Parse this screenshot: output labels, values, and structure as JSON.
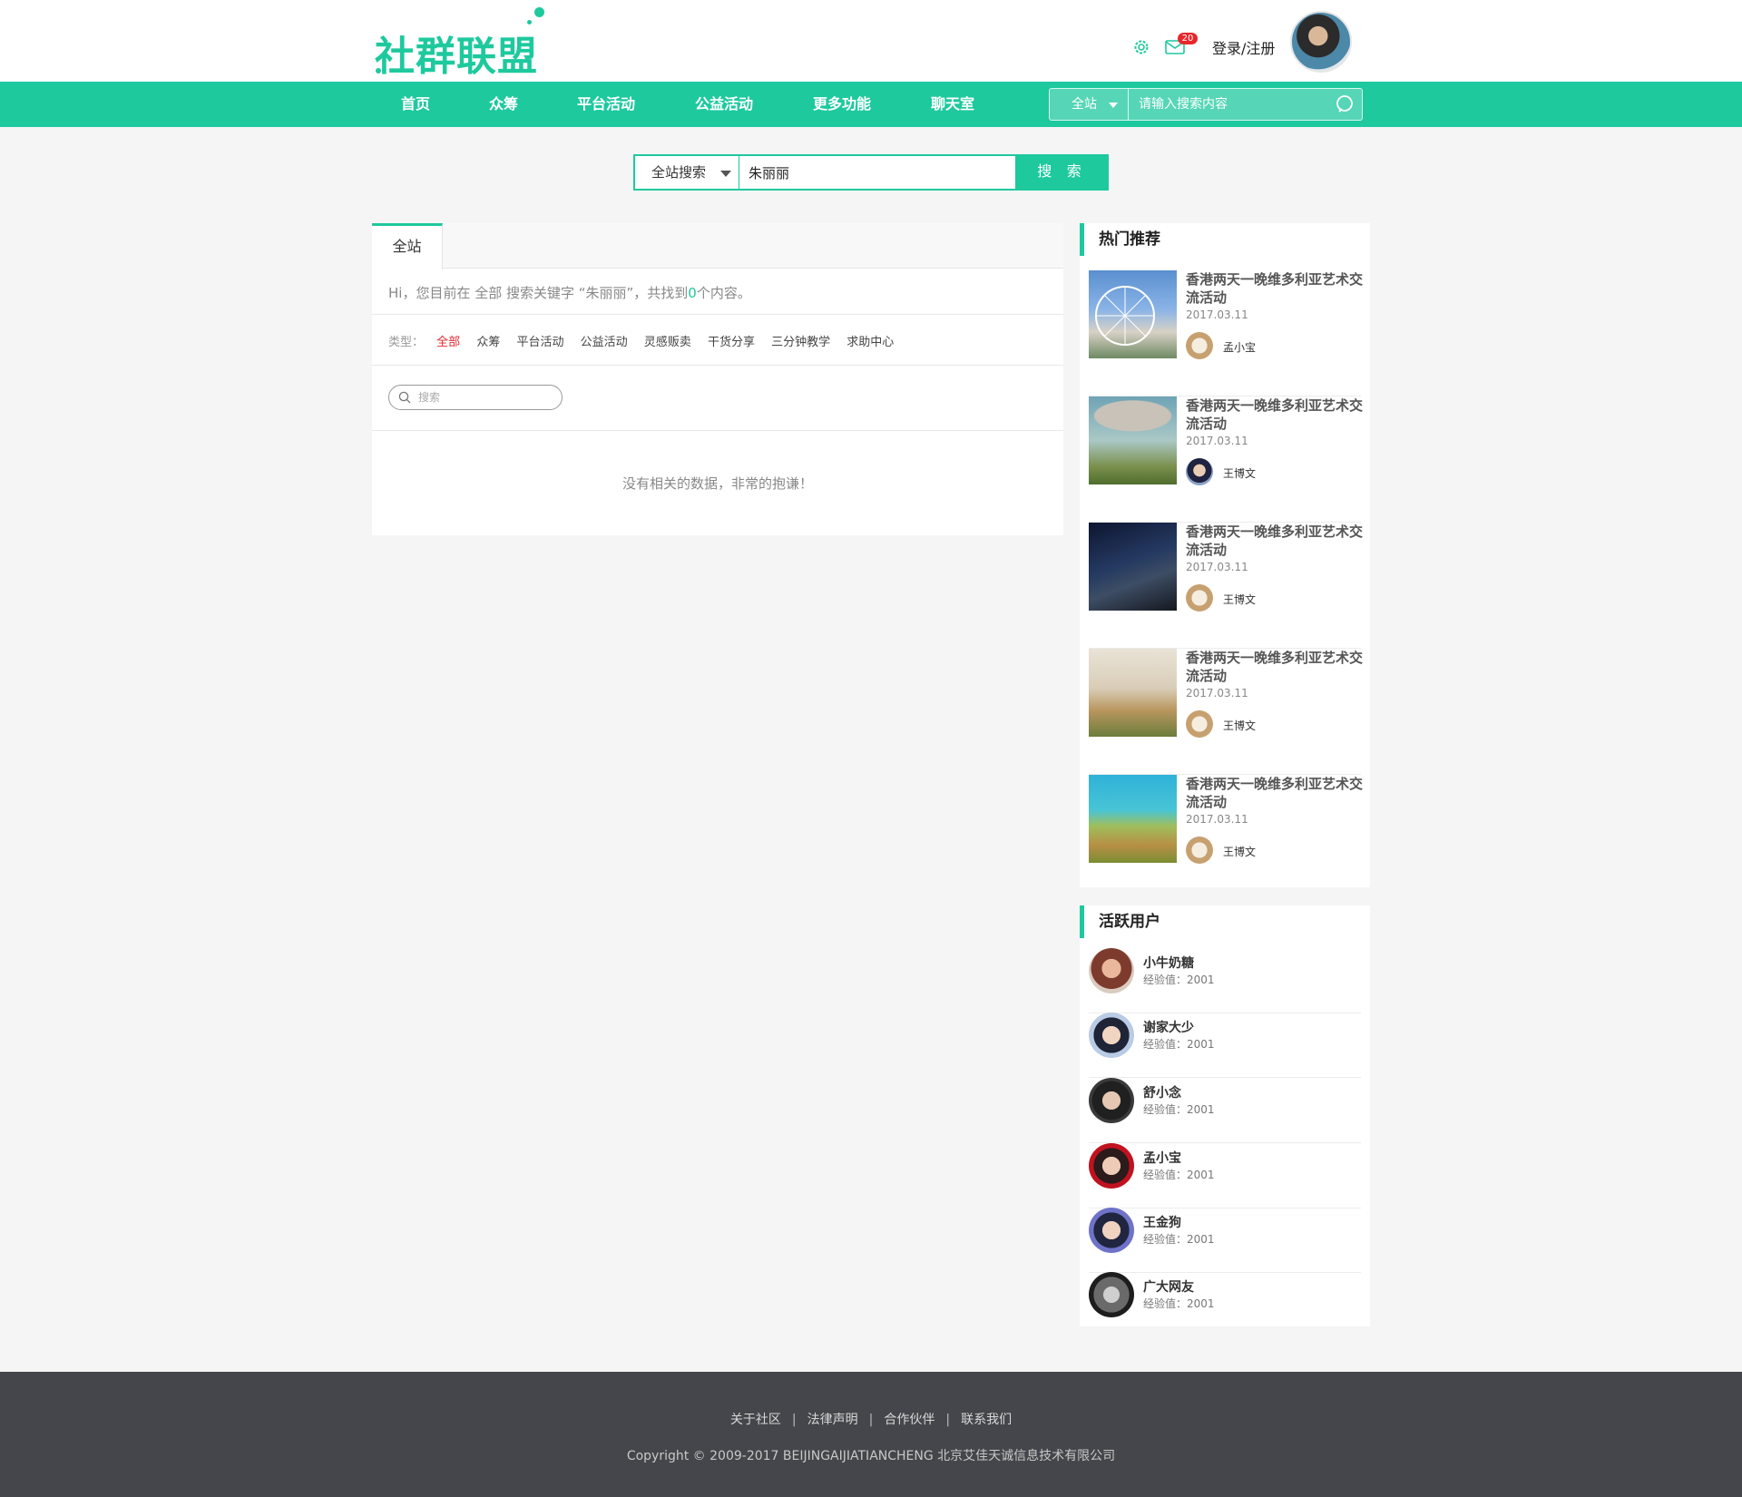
{
  "header": {
    "logo_text": "社群联盟",
    "mail_badge": "20",
    "login_label": "登录/注册",
    "brand_color": "#1ec99e"
  },
  "nav": {
    "items": [
      {
        "label": "首页"
      },
      {
        "label": "众筹"
      },
      {
        "label": "平台活动"
      },
      {
        "label": "公益活动"
      },
      {
        "label": "更多功能"
      },
      {
        "label": "聊天室"
      }
    ],
    "search_scope": "全站",
    "search_placeholder": "请输入搜索内容"
  },
  "main_search": {
    "scope": "全站搜索",
    "value": "朱丽丽",
    "button": "搜 索"
  },
  "results": {
    "tab": "全站",
    "hint_prefix": "Hi，您目前在 全部 搜索关键字 “朱丽丽”，共找到",
    "count": "0",
    "hint_suffix": "个内容。",
    "types_label": "类型：",
    "types": [
      "全部",
      "众筹",
      "平台活动",
      "公益活动",
      "灵感贩卖",
      "干货分享",
      "三分钟教学",
      "求助中心"
    ],
    "active_type": "全部",
    "mini_search_placeholder": "搜索",
    "empty_text": "没有相关的数据，非常的抱谦！"
  },
  "recommend": {
    "title": "热门推荐",
    "items": [
      {
        "title": "香港两天一晚维多利亚艺术交流活动",
        "date": "2017.03.11",
        "author": "孟小宝"
      },
      {
        "title": "香港两天一晚维多利亚艺术交流活动",
        "date": "2017.03.11",
        "author": "王博文"
      },
      {
        "title": "香港两天一晚维多利亚艺术交流活动",
        "date": "2017.03.11",
        "author": "王博文"
      },
      {
        "title": "香港两天一晚维多利亚艺术交流活动",
        "date": "2017.03.11",
        "author": "王博文"
      },
      {
        "title": "香港两天一晚维多利亚艺术交流活动",
        "date": "2017.03.11",
        "author": "王博文"
      }
    ]
  },
  "active_users": {
    "title": "活跃用户",
    "users": [
      {
        "name": "小牛奶糖",
        "exp": "经验值：2001"
      },
      {
        "name": "谢家大少",
        "exp": "经验值：2001"
      },
      {
        "name": "舒小念",
        "exp": "经验值：2001"
      },
      {
        "name": "孟小宝",
        "exp": "经验值：2001"
      },
      {
        "name": "王金狗",
        "exp": "经验值：2001"
      },
      {
        "name": "广大网友",
        "exp": "经验值：2001"
      }
    ]
  },
  "footer": {
    "links": [
      "关于社区",
      "法律声明",
      "合作伙伴",
      "联系我们"
    ],
    "copyright": "Copyright © 2009-2017 BEIJINGAIJIATIANCHENG 北京艾佳天诚信息技术有限公司"
  }
}
